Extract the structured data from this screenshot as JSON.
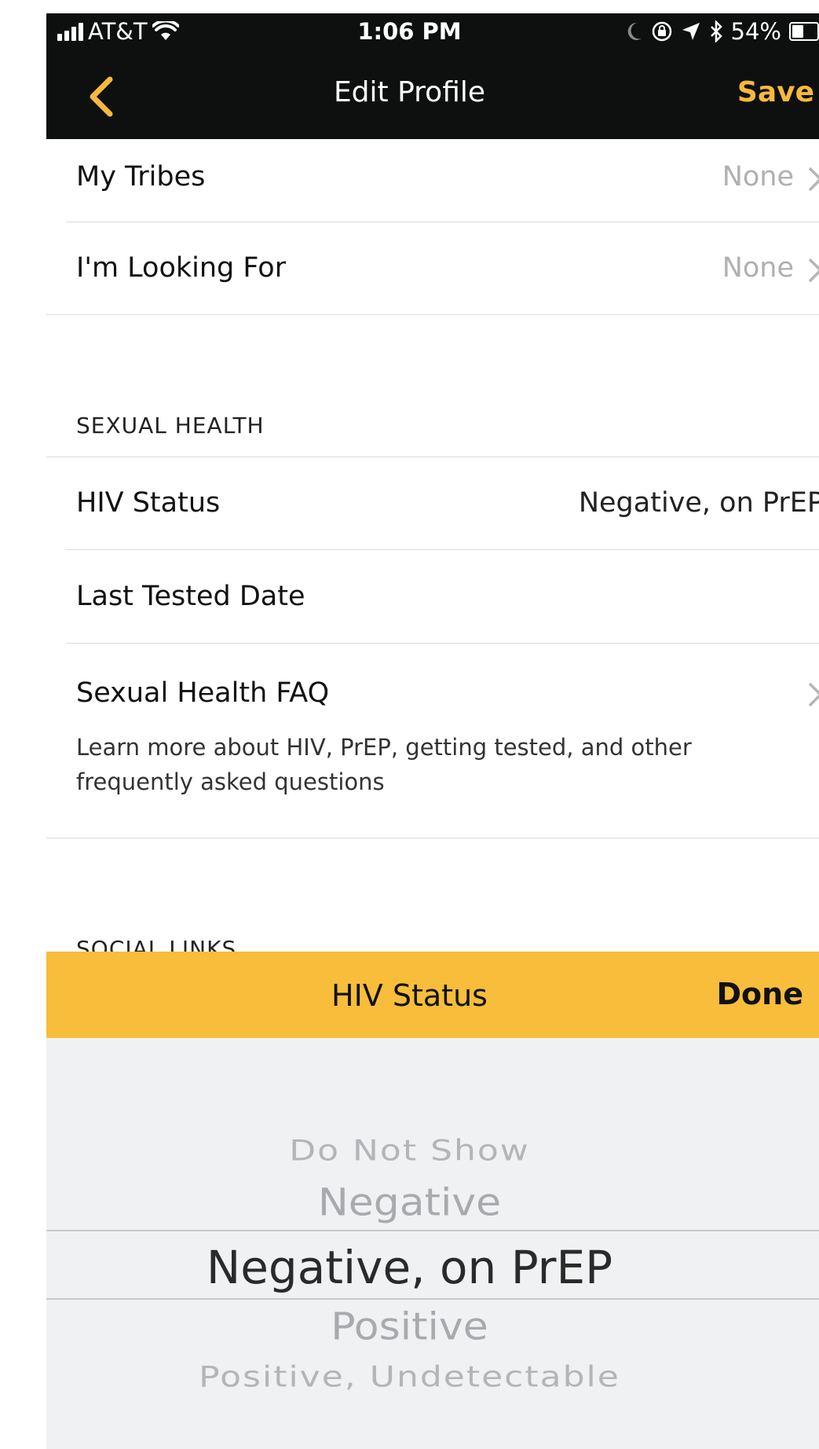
{
  "status_bar": {
    "carrier": "AT&T",
    "time": "1:06 PM",
    "battery_percent": "54%",
    "battery_level": 0.54
  },
  "nav": {
    "title": "Edit Profile",
    "save_label": "Save"
  },
  "rows": {
    "tribes": {
      "label": "My Tribes",
      "value": "None"
    },
    "looking_for": {
      "label": "I'm Looking For",
      "value": "None"
    },
    "hiv_status": {
      "label": "HIV Status",
      "value": "Negative, on PrEP"
    },
    "last_tested": {
      "label": "Last Tested Date"
    },
    "faq": {
      "label": "Sexual Health FAQ",
      "description": "Learn more about HIV, PrEP, getting tested, and other frequently asked questions"
    }
  },
  "sections": {
    "sexual_health": "SEXUAL HEALTH",
    "social_links": "SOCIAL LINKS"
  },
  "picker": {
    "title": "HIV Status",
    "done_label": "Done",
    "options": [
      "Do Not Show",
      "Negative",
      "Negative, on PrEP",
      "Positive",
      "Positive, Undetectable"
    ],
    "selected": "Negative, on PrEP"
  },
  "colors": {
    "accent": "#f6b93b",
    "toolbar": "#f7bd3b",
    "bar_background": "#0e0f0f",
    "picker_background": "#f0f1f3"
  }
}
